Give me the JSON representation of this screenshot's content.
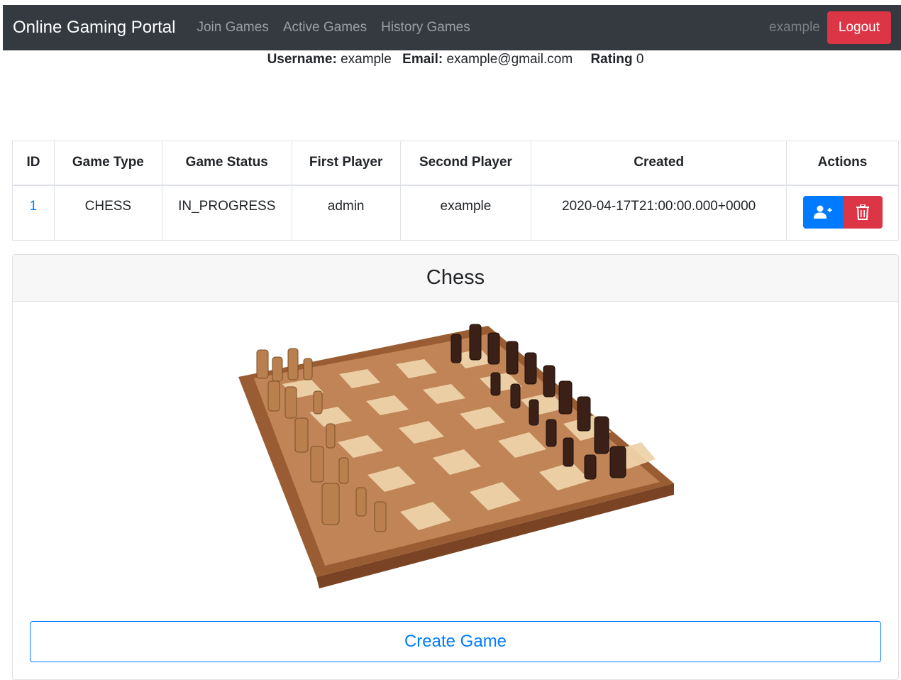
{
  "navbar": {
    "brand": "Online Gaming Portal",
    "links": [
      "Join Games",
      "Active Games",
      "History Games"
    ],
    "username": "example",
    "logout_label": "Logout"
  },
  "user_info": {
    "username_label": "Username:",
    "username": "example",
    "email_label": "Email:",
    "email": "example@gmail.com",
    "rating_label": "Rating",
    "rating": "0"
  },
  "table": {
    "headers": [
      "ID",
      "Game Type",
      "Game Status",
      "First Player",
      "Second Player",
      "Created",
      "Actions"
    ],
    "rows": [
      {
        "id": "1",
        "game_type": "CHESS",
        "game_status": "IN_PROGRESS",
        "first_player": "admin",
        "second_player": "example",
        "created": "2020-04-17T21:00:00.000+0000"
      }
    ]
  },
  "card": {
    "title": "Chess",
    "create_label": "Create Game"
  },
  "colors": {
    "navbar_bg": "#343a40",
    "primary": "#007bff",
    "danger": "#dc3545"
  }
}
